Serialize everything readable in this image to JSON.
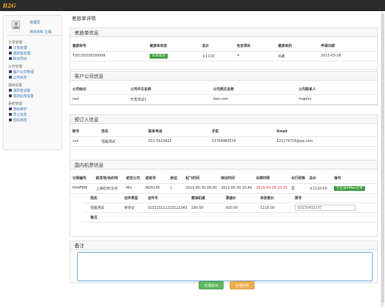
{
  "logo": "B2G",
  "user": {
    "name": "管理员",
    "links": "修改资料 注销"
  },
  "menu": [
    {
      "title": "订单管理",
      "items": [
        "订单处理",
        "退改签处理",
        "账单导出"
      ]
    },
    {
      "title": "公司管理",
      "items": [
        "客户公司管理",
        "公司信息"
      ]
    },
    {
      "title": "基础设置",
      "items": [
        "退改签设置",
        "退改后规设置"
      ]
    },
    {
      "title": "系统管理",
      "items": [
        "角色维护",
        "员工信息",
        "密码修改"
      ]
    }
  ],
  "page_title": "差旅单详情",
  "sections": {
    "order": {
      "title": "差旅单信息",
      "headers": [
        "差旅单号",
        "差旅单状态",
        "总价",
        "包含项目",
        "差旅目的",
        "申请日期"
      ],
      "row": [
        "T20130328100008",
        "出票成功",
        "￥1110",
        "✈",
        "出差",
        "2013-03-28"
      ]
    },
    "company": {
      "title": "客户公司信息",
      "headers": [
        "公司标识",
        "公司中文名称",
        "公司英文名称",
        "公司联系人"
      ],
      "row": [
        "test",
        "开发测试1",
        "test.com",
        "maphis"
      ]
    },
    "booker": {
      "title": "预订人信息",
      "headers": [
        "账号",
        "姓名",
        "联系电话",
        "手机",
        "Email"
      ],
      "row": [
        "xxx",
        "恒履测试",
        "021-5923422",
        "13764982514",
        "122174716@qq.com"
      ]
    },
    "ticket": {
      "title": "国内机票信息",
      "headers": [
        "记录编号",
        "航发地/目的地",
        "航空公司",
        "航班号",
        "舱位",
        "起飞时间",
        "到达时间",
        "出票时限",
        "出行政策",
        "总价",
        "操作"
      ],
      "row": [
        "HV4FRM",
        "上海虹桥/北京",
        "MU",
        "MU5145",
        "L",
        "2013-05-30 08:30",
        "2013-05-30 10:40",
        "2013-03-28 10:15",
        "否",
        "￥1110.00",
        "已生成XMeo订单"
      ],
      "passenger_headers": [
        "姓名",
        "证件类型",
        "证件号",
        "燃油机建",
        "票面价",
        "单张售价",
        "票号"
      ],
      "passenger_row": [
        "恒履测试",
        "身份证",
        "310115111222122343",
        "190.00",
        "920.00",
        "1110.00",
        "03135432237"
      ],
      "remark_label": "备注"
    },
    "remarks": {
      "title": "备注"
    }
  },
  "buttons": {
    "success": "处理成功",
    "fail": "处理失败"
  }
}
